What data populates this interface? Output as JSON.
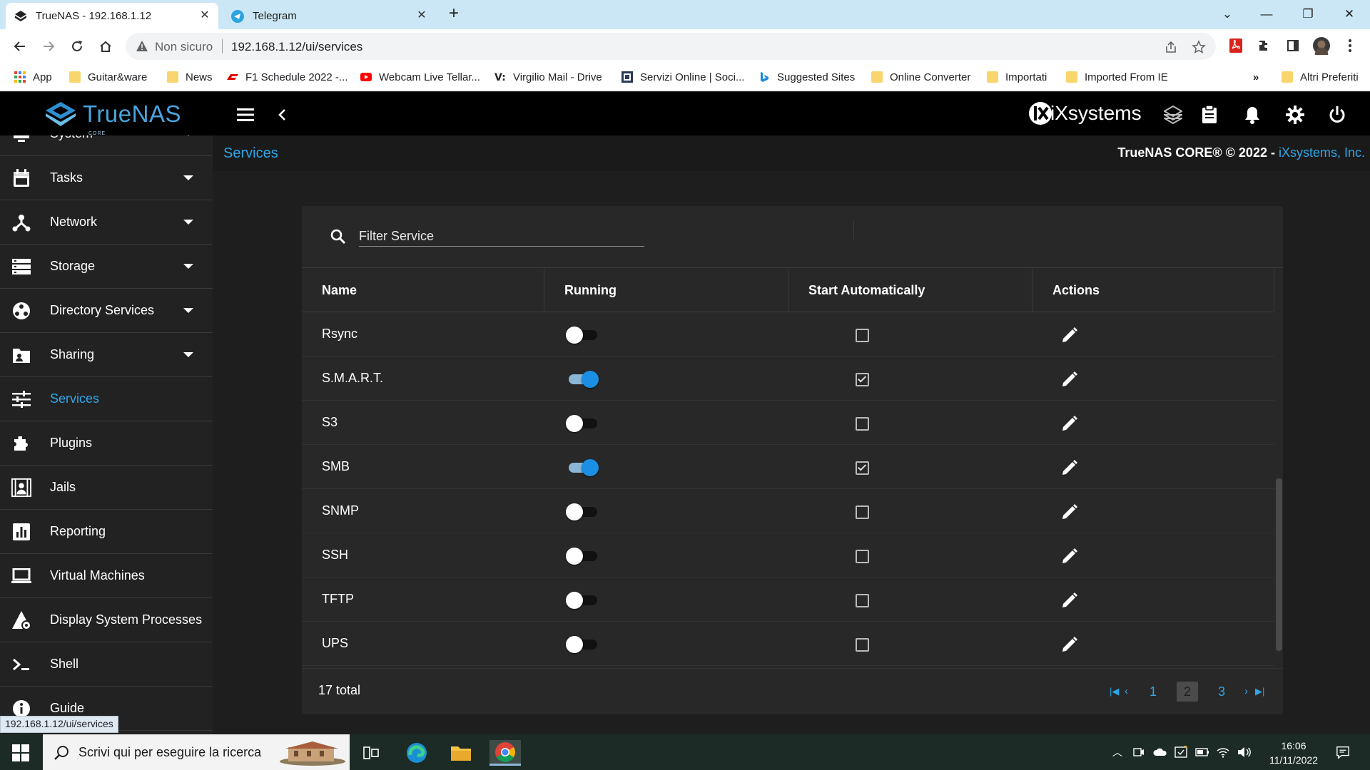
{
  "browser": {
    "tabs": [
      {
        "title": "TrueNAS - 192.168.1.12",
        "active": true
      },
      {
        "title": "Telegram",
        "active": false
      }
    ],
    "address": {
      "security_label": "Non sicuro",
      "url": "192.168.1.12/ui/services"
    },
    "bookmarks": [
      {
        "label": "App",
        "icon": "apps-grid-icon"
      },
      {
        "label": "Guitar&ware",
        "icon": "folder-icon"
      },
      {
        "label": "News",
        "icon": "folder-icon"
      },
      {
        "label": "F1 Schedule 2022 -...",
        "icon": "f1-icon"
      },
      {
        "label": "Webcam Live Tellar...",
        "icon": "youtube-icon"
      },
      {
        "label": "Virgilio Mail - Drive",
        "icon": "virgilio-icon"
      },
      {
        "label": "Servizi Online | Soci...",
        "icon": "site-icon"
      },
      {
        "label": "Suggested Sites",
        "icon": "bing-icon"
      },
      {
        "label": "Online Converter",
        "icon": "folder-icon"
      },
      {
        "label": "Importati",
        "icon": "folder-icon"
      },
      {
        "label": "Imported From IE",
        "icon": "folder-icon"
      }
    ],
    "bookmarks_overflow": "»",
    "other_bookmarks": "Altri Preferiti",
    "status_url": "192.168.1.12/ui/services"
  },
  "app": {
    "brand": "TrueNAS",
    "brand_sub": "CORE",
    "vendor_logo": "iXsystems",
    "breadcrumb": "Services",
    "copyright": "TrueNAS CORE® © 2022 - ",
    "copyright_link": "iXsystems, Inc.",
    "sidebar": [
      {
        "label": "System",
        "icon": "system-icon",
        "expandable": true
      },
      {
        "label": "Tasks",
        "icon": "calendar-icon",
        "expandable": true
      },
      {
        "label": "Network",
        "icon": "network-icon",
        "expandable": true
      },
      {
        "label": "Storage",
        "icon": "storage-icon",
        "expandable": true
      },
      {
        "label": "Directory Services",
        "icon": "directory-icon",
        "expandable": true
      },
      {
        "label": "Sharing",
        "icon": "sharing-icon",
        "expandable": true
      },
      {
        "label": "Services",
        "icon": "services-icon",
        "expandable": false,
        "active": true
      },
      {
        "label": "Plugins",
        "icon": "puzzle-icon",
        "expandable": false
      },
      {
        "label": "Jails",
        "icon": "jail-icon",
        "expandable": false
      },
      {
        "label": "Reporting",
        "icon": "chart-icon",
        "expandable": false
      },
      {
        "label": "Virtual Machines",
        "icon": "laptop-icon",
        "expandable": false
      },
      {
        "label": "Display System Processes",
        "icon": "processes-icon",
        "expandable": false
      },
      {
        "label": "Shell",
        "icon": "shell-icon",
        "expandable": false
      },
      {
        "label": "Guide",
        "icon": "info-icon",
        "expandable": false
      }
    ],
    "services": {
      "filter_placeholder": "Filter Service",
      "columns": [
        "Name",
        "Running",
        "Start Automatically",
        "Actions"
      ],
      "rows": [
        {
          "name": "Rsync",
          "running": false,
          "auto": false
        },
        {
          "name": "S.M.A.R.T.",
          "running": true,
          "auto": true
        },
        {
          "name": "S3",
          "running": false,
          "auto": false
        },
        {
          "name": "SMB",
          "running": true,
          "auto": true
        },
        {
          "name": "SNMP",
          "running": false,
          "auto": false
        },
        {
          "name": "SSH",
          "running": false,
          "auto": false
        },
        {
          "name": "TFTP",
          "running": false,
          "auto": false
        },
        {
          "name": "UPS",
          "running": false,
          "auto": false
        }
      ],
      "total": "17 total",
      "pagination": {
        "pages": [
          "1",
          "2",
          "3"
        ],
        "current": "2"
      }
    }
  },
  "taskbar": {
    "search_placeholder": "Scrivi qui per eseguire la ricerca",
    "time": "16:06",
    "date": "11/11/2022"
  },
  "colors": {
    "accent": "#2ea7e8",
    "toggle_on": "#1a8fe3",
    "sidebar_bg": "#222222",
    "card_bg": "#282828"
  }
}
